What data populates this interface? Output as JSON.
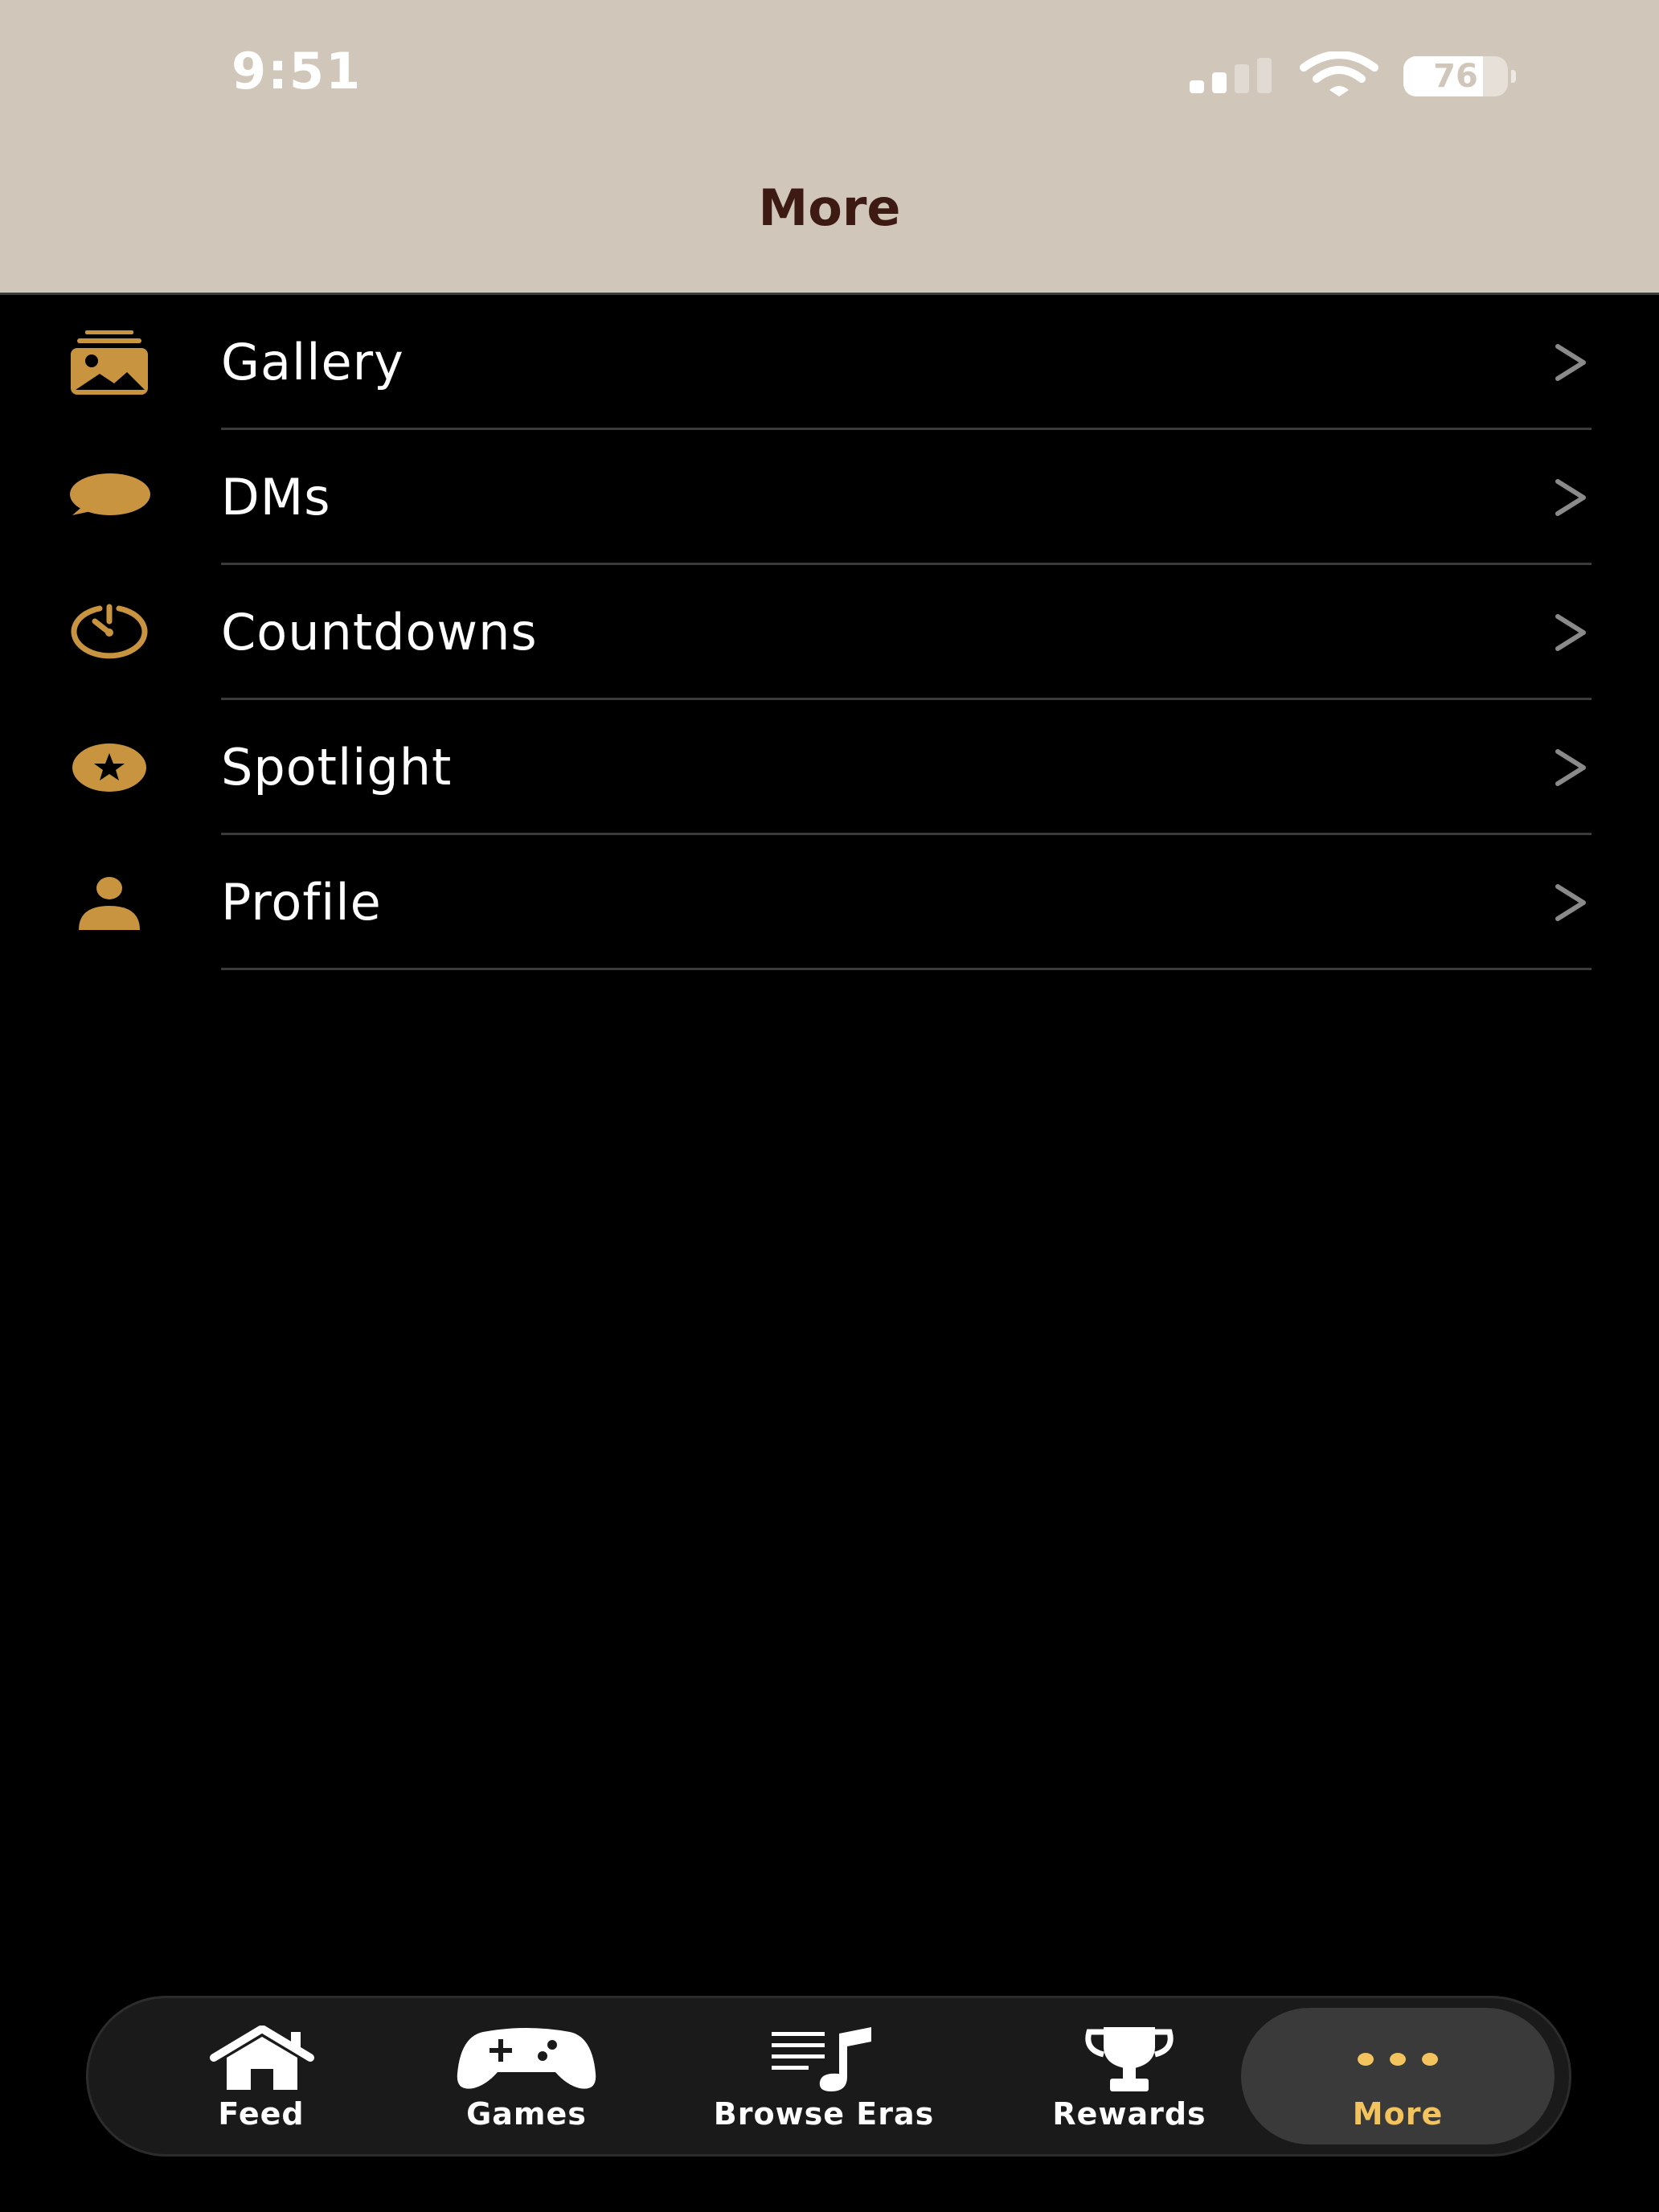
{
  "status_bar": {
    "time": "9:51",
    "battery": "76",
    "battery_level_percent": 76,
    "signal_bars_filled": 2,
    "signal_bars_total": 4
  },
  "header": {
    "title": "More"
  },
  "colors": {
    "accent": "#c89440",
    "active_tab": "#f3c35e",
    "header_bg": "#d1c6ba",
    "title": "#3e1a14"
  },
  "menu": {
    "items": [
      {
        "label": "Gallery",
        "icon": "gallery-icon"
      },
      {
        "label": "DMs",
        "icon": "chat-bubble-icon"
      },
      {
        "label": "Countdowns",
        "icon": "timer-icon"
      },
      {
        "label": "Spotlight",
        "icon": "star-circle-icon"
      },
      {
        "label": "Profile",
        "icon": "person-icon"
      }
    ]
  },
  "tabbar": {
    "items": [
      {
        "label": "Feed",
        "icon": "house-icon"
      },
      {
        "label": "Games",
        "icon": "gamepad-icon"
      },
      {
        "label": "Browse Eras",
        "icon": "music-list-icon"
      },
      {
        "label": "Rewards",
        "icon": "trophy-icon"
      },
      {
        "label": "More",
        "icon": "ellipsis-icon"
      }
    ],
    "active": "More"
  }
}
